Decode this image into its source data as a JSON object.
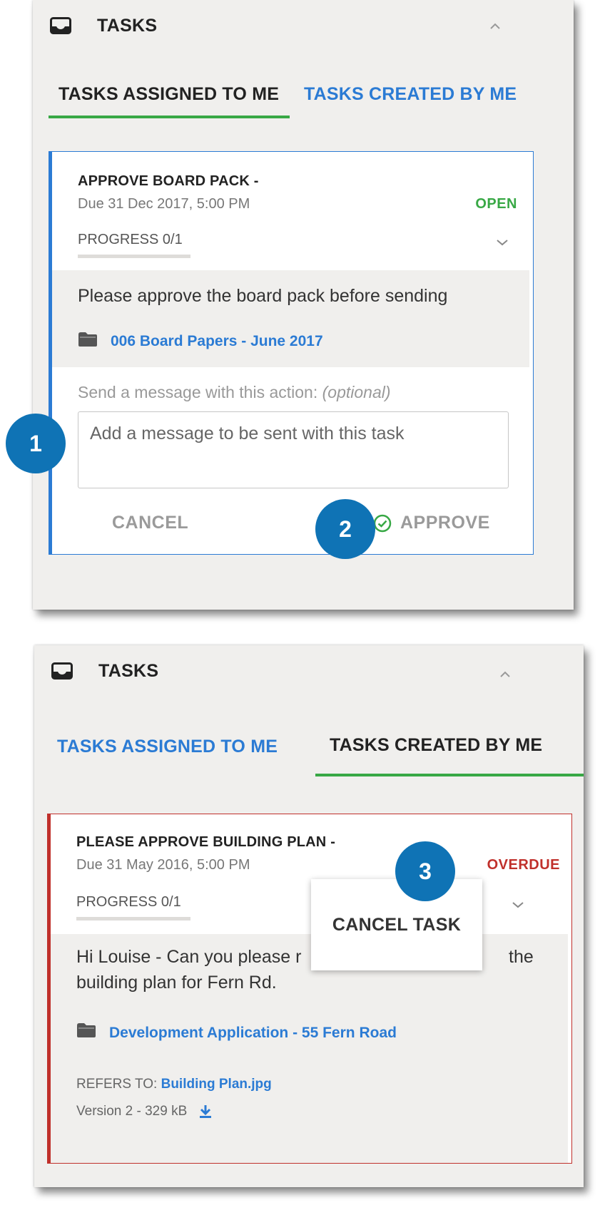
{
  "panel1": {
    "header_title": "TASKS",
    "tabs": {
      "assigned": "TASKS ASSIGNED TO ME",
      "created": "TASKS CREATED BY ME"
    },
    "card": {
      "title": "APPROVE BOARD PACK -",
      "due": "Due 31 Dec 2017, 5:00 PM",
      "status": "OPEN",
      "progress_label": "PROGRESS 0/1",
      "progress_fraction": 0,
      "description": "Please approve the board pack before sending",
      "folder_link": "006 Board Papers - June 2017",
      "message_label": "Send a message with this action:",
      "message_optional": "(optional)",
      "message_placeholder": "Add a message to be sent with this task",
      "cancel_label": "CANCEL",
      "approve_label": "APPROVE"
    },
    "badges": {
      "one": "1",
      "two": "2"
    }
  },
  "panel2": {
    "header_title": "TASKS",
    "tabs": {
      "assigned": "TASKS ASSIGNED TO ME",
      "created": "TASKS CREATED BY ME"
    },
    "card": {
      "title": "PLEASE APPROVE BUILDING PLAN -",
      "due": "Due 31 May 2016, 5:00 PM",
      "status": "OVERDUE",
      "progress_label": "PROGRESS 0/1",
      "progress_fraction": 0,
      "more_label": "•••",
      "description_line1_start": "Hi Louise - Can you please r",
      "description_line1_end": "the",
      "description_line2": "building plan for Fern Rd.",
      "folder_link": "Development Application - 55 Fern Road",
      "refers_to_label": "REFERS TO:",
      "refers_to_file": "Building Plan.jpg",
      "version_info": "Version 2 - 329 kB",
      "popup_item": "CANCEL TASK"
    },
    "badges": {
      "three": "3"
    }
  },
  "colors": {
    "accent_blue": "#2b7bd4",
    "active_green": "#38a845",
    "overdue_red": "#c0302b",
    "badge_blue": "#0f73b5",
    "card_border_blue": "#2b7bd4"
  }
}
